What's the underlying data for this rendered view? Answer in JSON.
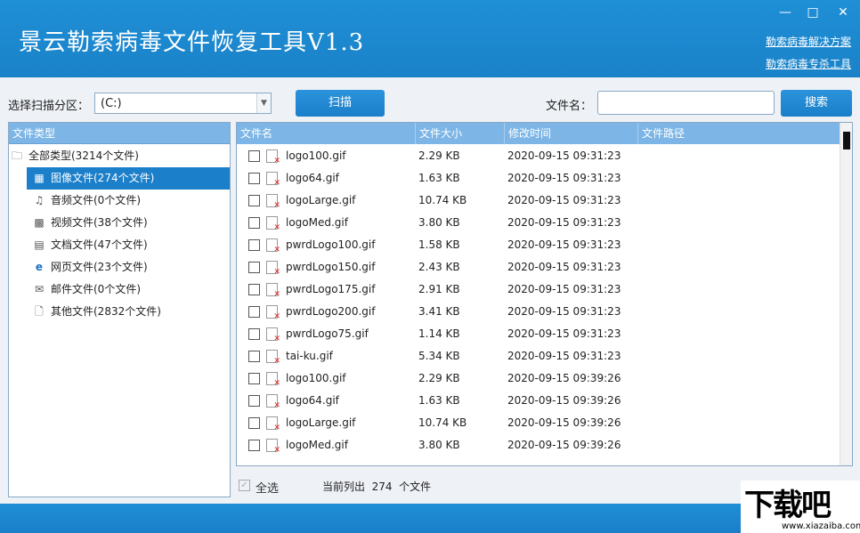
{
  "app": {
    "title": "景云勒索病毒文件恢复工具V1.3",
    "links": [
      "勒索病毒解决方案",
      "勒索病毒专杀工具"
    ],
    "window_controls": [
      "minimize-icon",
      "maximize-icon",
      "close-icon"
    ]
  },
  "toolbar": {
    "partition_label": "选择扫描分区：",
    "partition_value": "(C:)",
    "scan_label": "扫描",
    "filename_label": "文件名：",
    "filename_value": "",
    "search_label": "搜索"
  },
  "tree": {
    "header": "文件类型",
    "items": [
      {
        "label": "全部类型(3214个文件)",
        "icon": "folder-icon"
      },
      {
        "label": "图像文件(274个文件)",
        "icon": "image-file-icon",
        "selected": true
      },
      {
        "label": "音频文件(0个文件)",
        "icon": "audio-file-icon"
      },
      {
        "label": "视频文件(38个文件)",
        "icon": "video-file-icon"
      },
      {
        "label": "文档文件(47个文件)",
        "icon": "document-file-icon"
      },
      {
        "label": "网页文件(23个文件)",
        "icon": "web-file-icon"
      },
      {
        "label": "邮件文件(0个文件)",
        "icon": "mail-file-icon"
      },
      {
        "label": "其他文件(2832个文件)",
        "icon": "other-file-icon"
      }
    ]
  },
  "list": {
    "columns": [
      "文件名",
      "文件大小",
      "修改时间",
      "文件路径"
    ],
    "rows": [
      {
        "name": "logo100.gif",
        "size": "2.29 KB",
        "time": "2020-09-15   09:31:23"
      },
      {
        "name": "logo64.gif",
        "size": "1.63 KB",
        "time": "2020-09-15   09:31:23"
      },
      {
        "name": "logoLarge.gif",
        "size": "10.74 KB",
        "time": "2020-09-15   09:31:23"
      },
      {
        "name": "logoMed.gif",
        "size": "3.80 KB",
        "time": "2020-09-15   09:31:23"
      },
      {
        "name": "pwrdLogo100.gif",
        "size": "1.58 KB",
        "time": "2020-09-15   09:31:23"
      },
      {
        "name": "pwrdLogo150.gif",
        "size": "2.43 KB",
        "time": "2020-09-15   09:31:23"
      },
      {
        "name": "pwrdLogo175.gif",
        "size": "2.91 KB",
        "time": "2020-09-15   09:31:23"
      },
      {
        "name": "pwrdLogo200.gif",
        "size": "3.41 KB",
        "time": "2020-09-15   09:31:23"
      },
      {
        "name": "pwrdLogo75.gif",
        "size": "1.14 KB",
        "time": "2020-09-15   09:31:23"
      },
      {
        "name": "tai-ku.gif",
        "size": "5.34 KB",
        "time": "2020-09-15   09:31:23"
      },
      {
        "name": "logo100.gif",
        "size": "2.29 KB",
        "time": "2020-09-15   09:39:26"
      },
      {
        "name": "logo64.gif",
        "size": "1.63 KB",
        "time": "2020-09-15   09:39:26"
      },
      {
        "name": "logoLarge.gif",
        "size": "10.74 KB",
        "time": "2020-09-15   09:39:26"
      },
      {
        "name": "logoMed.gif",
        "size": "3.80 KB",
        "time": "2020-09-15   09:39:26"
      }
    ]
  },
  "footer": {
    "select_all_label": "全选",
    "count_text": "当前列出  274  个文件"
  },
  "watermark": {
    "logo_text": "下载吧",
    "site": "www.xiazaiba.com"
  },
  "colors": {
    "accent": "#1a82c8",
    "header": "#7db6e6",
    "selected": "#1c7fc9"
  }
}
